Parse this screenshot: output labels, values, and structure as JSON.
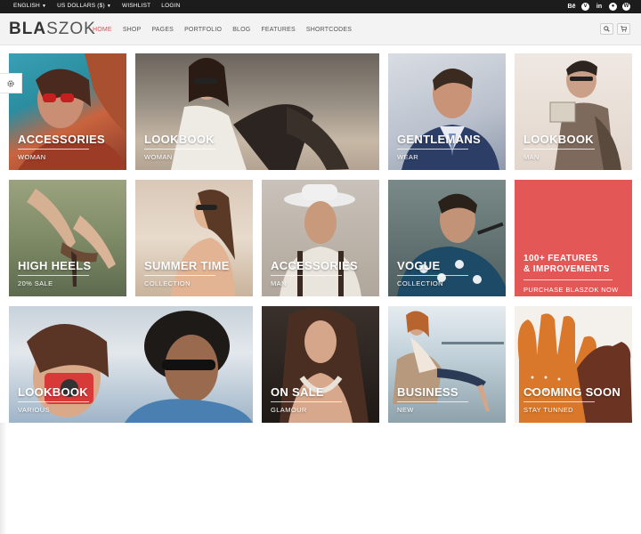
{
  "topbar": {
    "language": "ENGLISH",
    "currency": "US DOLLARS ($)",
    "wishlist": "WISHLIST",
    "login": "LOGIN",
    "social": [
      {
        "icon": "behance-icon",
        "glyph": "Bē"
      },
      {
        "icon": "vimeo-icon",
        "glyph": "v"
      },
      {
        "icon": "linkedin-icon",
        "glyph": "in"
      },
      {
        "icon": "tripadvisor-icon",
        "glyph": "●"
      },
      {
        "icon": "wordpress-icon",
        "glyph": "W"
      }
    ]
  },
  "header": {
    "logo_bold": "BLA",
    "logo_light": "SZOK",
    "nav": [
      "HOME",
      "SHOP",
      "PAGES",
      "PORTFOLIO",
      "BLOG",
      "FEATURES",
      "SHORTCODES"
    ],
    "active_nav": "HOME"
  },
  "tiles": [
    {
      "title": "ACCESSORIES",
      "subtitle": "WOMAN"
    },
    {
      "title": "LOOKBOOK",
      "subtitle": "WOMAN"
    },
    {
      "title": "GENTLEMANS",
      "subtitle": "WEAR"
    },
    {
      "title": "LOOKBOOK",
      "subtitle": "MAN"
    },
    {
      "title": "HIGH HEELS",
      "subtitle": "20% SALE"
    },
    {
      "title": "SUMMER TIME",
      "subtitle": "COLLECTION"
    },
    {
      "title": "ACCESSORIES",
      "subtitle": "MAN"
    },
    {
      "title": "VOGUE",
      "subtitle": "COLLECTION"
    },
    {
      "title_line1": "100+ FEATURES",
      "title_line2": "& IMPROVEMENTS",
      "subtitle": "PURCHASE BLASZOK NOW"
    },
    {
      "title": "LOOKBOOK",
      "subtitle": "VARIOUS"
    },
    {
      "title": "ON SALE",
      "subtitle": "GLAMOUR"
    },
    {
      "title": "BUSINESS",
      "subtitle": "NEW"
    },
    {
      "title": "COOMING SOON",
      "subtitle": "STAY TUNNED"
    }
  ],
  "colors": {
    "accent": "#e05050",
    "promo": "#e35756",
    "topbar": "#1c1c1c"
  }
}
